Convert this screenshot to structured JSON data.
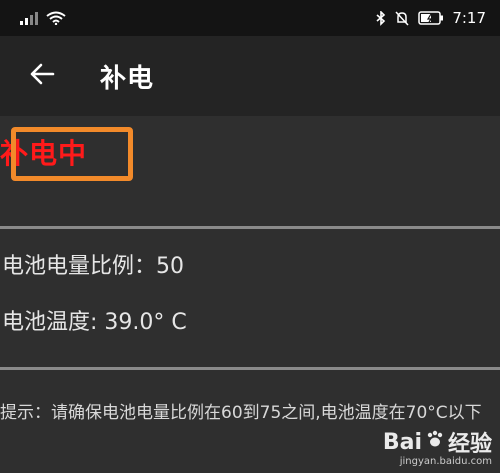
{
  "status_bar": {
    "time": "7:17",
    "icons": [
      "signal-icon",
      "wifi-icon",
      "bluetooth-icon",
      "mute-icon",
      "battery-charging-icon"
    ]
  },
  "app_bar": {
    "title": "补电",
    "back_icon": "arrow-left-icon"
  },
  "charging": {
    "status_text": "补电中",
    "color": "#ff1a1a",
    "highlight_color": "#f28a2a"
  },
  "battery": {
    "level_label": "电池电量比例：",
    "level_value": "50",
    "temp_label": "电池温度: ",
    "temp_value": "39.0° C"
  },
  "hint": {
    "text": "提示：请确保电池电量比例在60到75之间,电池温度在70°C以下"
  },
  "watermark": {
    "logo_text": "Bai",
    "logo_cn": "经验",
    "url": "jingyan.baidu.com"
  }
}
